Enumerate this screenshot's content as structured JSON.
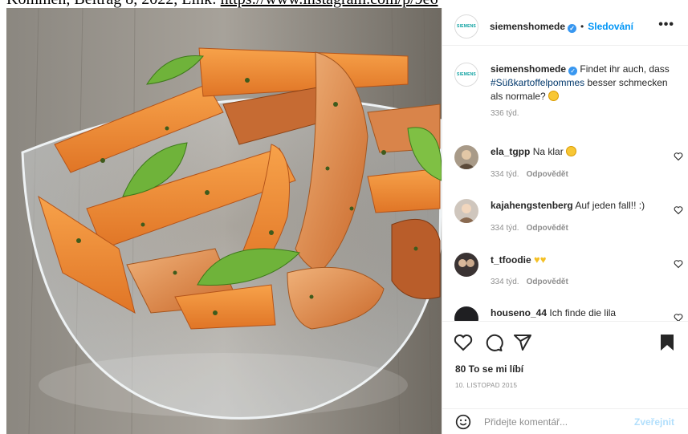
{
  "caption_top": {
    "text": "Kommen, Beitrag 8, 2022, Link:",
    "link": "https://www.instagram.com/p/9e6"
  },
  "post": {
    "account": "siemenshomede",
    "avatar_label": "SIEMENS",
    "follow_label": "Sledování",
    "separator": "•",
    "more_label": "•••",
    "caption": {
      "prefix": "Findet ihr auch, dass ",
      "hashtag": "#Süßkartoffelpommes",
      "suffix": " besser schmecken als normale?",
      "time": "336 týd."
    },
    "likes": "80 To se mi líbí",
    "date": "10. LISTOPAD 2015",
    "comment_placeholder": "Přidejte komentář...",
    "post_button": "Zveřejnit",
    "colors": {
      "accent": "#0095f6",
      "verified": "#3897f0",
      "muted": "#8e8e8e"
    }
  },
  "comments": [
    {
      "user": "ela_tgpp",
      "text": "Na klar",
      "time": "334 týd.",
      "reply": "Odpovědět",
      "emoji": "grinning-face"
    },
    {
      "user": "kajahengstenberg",
      "text": "Auf jeden fall!! :)",
      "time": "334 týd.",
      "reply": "Odpovědět"
    },
    {
      "user": "t_tfoodie",
      "text": "",
      "time": "334 týd.",
      "reply": "Odpovědět",
      "emoji": "yellow-heart yellow-heart"
    },
    {
      "user": "houseno_44",
      "text": "Ich finde die lila",
      "time": "",
      "reply": ""
    }
  ],
  "icons": [
    "heart-icon",
    "comment-icon",
    "share-icon",
    "bookmark-icon",
    "smile-icon",
    "verified-icon"
  ]
}
